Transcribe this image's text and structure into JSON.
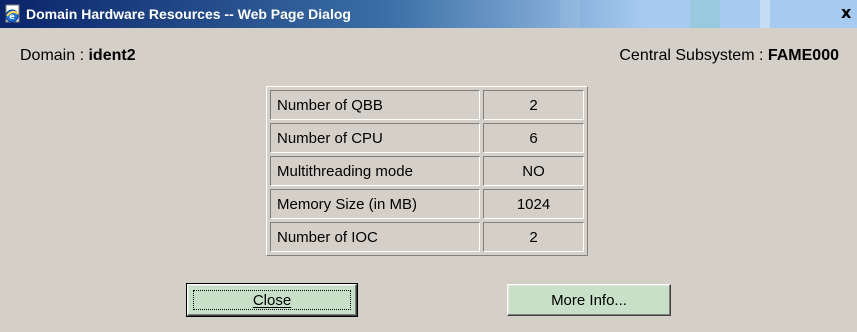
{
  "window": {
    "title": "Domain Hardware Resources -- Web Page Dialog",
    "close_glyph": "x"
  },
  "header": {
    "domain_label": "Domain : ",
    "domain_value": "ident2",
    "central_subsystem_label": "Central Subsystem : ",
    "central_subsystem_value": "FAME000"
  },
  "resources": {
    "rows": [
      {
        "label": "Number of QBB",
        "value": "2"
      },
      {
        "label": "Number of CPU",
        "value": "6"
      },
      {
        "label": "Multithreading mode",
        "value": "NO"
      },
      {
        "label": "Memory Size (in MB)",
        "value": "1024"
      },
      {
        "label": "Number of IOC",
        "value": "2"
      }
    ]
  },
  "buttons": {
    "close_label": "Close",
    "more_info_label": "More Info..."
  },
  "colors": {
    "dialog_bg": "#d4d0c8",
    "titlebar_start": "#0a246a",
    "button_bg": "#c7e0c7"
  },
  "icons": {
    "title_icon": "ie-page-icon"
  }
}
